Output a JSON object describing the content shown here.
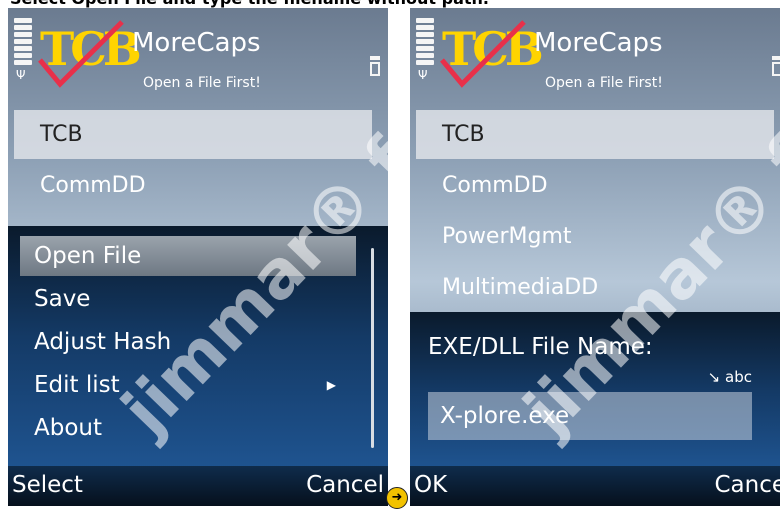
{
  "caption": "Select Open File and type the filename without path.",
  "watermark": "jimmar® forum",
  "app": {
    "logo_text": "TCB",
    "title": "MoreCaps",
    "subtitle": "Open  a File First!"
  },
  "left": {
    "list": [
      "TCB",
      "CommDD"
    ],
    "menu": {
      "items": [
        {
          "label": "Open File",
          "selected": true,
          "submenu": false
        },
        {
          "label": "Save",
          "selected": false,
          "submenu": false
        },
        {
          "label": "Adjust Hash",
          "selected": false,
          "submenu": false
        },
        {
          "label": "Edit list",
          "selected": false,
          "submenu": true
        },
        {
          "label": "About",
          "selected": false,
          "submenu": false
        }
      ]
    },
    "softkeys": {
      "left": "Select",
      "right": "Cancel"
    }
  },
  "right": {
    "list": [
      "TCB",
      "CommDD",
      "PowerMgmt",
      "MultimediaDD"
    ],
    "form": {
      "label": "EXE/DLL File Name:",
      "input_mode": "abc",
      "value": "X-plore.exe"
    },
    "softkeys": {
      "left": "OK",
      "right": "Cance"
    }
  },
  "colors": {
    "logo_yellow": "#ffd400",
    "logo_check": "#e8304a",
    "menu_bg": "#143a66"
  }
}
